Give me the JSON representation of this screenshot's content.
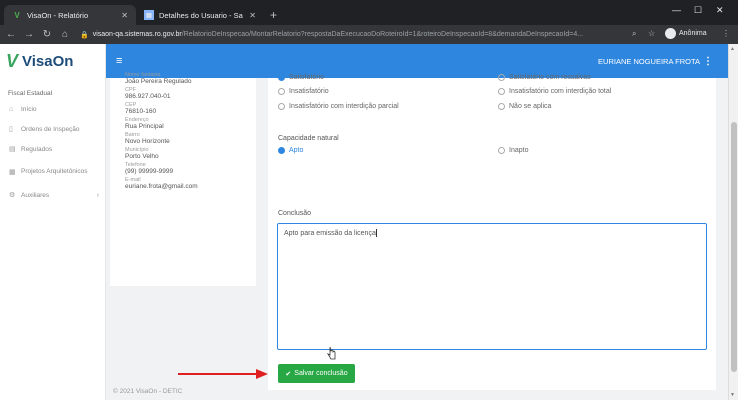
{
  "browser": {
    "tabs": [
      {
        "title": "VisaOn - Relatório",
        "active": true
      },
      {
        "title": "Detalhes do Usuario - Sauron.Go",
        "active": false
      }
    ],
    "new_tab": "+",
    "window_controls": [
      "—",
      "☐",
      "✕"
    ],
    "url_host": "visaon-qa.sistemas.ro.gov.br",
    "url_path": "/RelatorioDeInspecao/MontarRelatorio?respostaDaExecucaoDoRoteiroId=1&roteiroDeInspecaoId=8&demandaDeInspecaoId=4...",
    "profile_label": "Anônima"
  },
  "app": {
    "brand": "VisaOn",
    "subtitle": "Fiscal Estadual",
    "user_name": "EURIANE NOGUEIRA FROTA",
    "footer": "© 2021 VisaOn - DETIC"
  },
  "sidebar": {
    "items": [
      {
        "label": "Início",
        "icon": "home-icon"
      },
      {
        "label": "Ordens de Inspeção",
        "icon": "file-icon"
      },
      {
        "label": "Regulados",
        "icon": "document-icon"
      },
      {
        "label": "Projetos Arquitetônicos",
        "icon": "blueprint-icon"
      },
      {
        "label": "Auxiliares",
        "icon": "gears-icon"
      }
    ]
  },
  "regulado": {
    "fields": [
      {
        "key": "Nome fantasia",
        "value": "João Pereira Regulado"
      },
      {
        "key": "CPF",
        "value": "986.927.040-01"
      },
      {
        "key": "CEP",
        "value": "76810-160"
      },
      {
        "key": "Endereço",
        "value": "Rua Principal"
      },
      {
        "key": "Bairro",
        "value": "Novo Horizonte"
      },
      {
        "key": "Município",
        "value": "Porto Velho"
      },
      {
        "key": "Telefone",
        "value": "(99) 99999-9999"
      },
      {
        "key": "E-mail",
        "value": "euriane.frota@gmail.com"
      }
    ]
  },
  "form": {
    "top_partial_left": "Satisfatório",
    "top_partial_right": "Satisfatório com ressalvas",
    "situation_options": [
      {
        "label": "Insatisfatório"
      },
      {
        "label": "Insatisfatório com interdição total"
      },
      {
        "label": "Insatisfatório com interdição parcial"
      },
      {
        "label": "Não se aplica"
      }
    ],
    "capacity_label": "Capacidade natural",
    "capacity_options": [
      {
        "label": "Apto",
        "selected": true
      },
      {
        "label": "Inapto",
        "selected": false
      }
    ],
    "conclusion_label": "Conclusão",
    "conclusion_value": "Apto para emissão da licença",
    "save_button": "Salvar conclusão"
  }
}
